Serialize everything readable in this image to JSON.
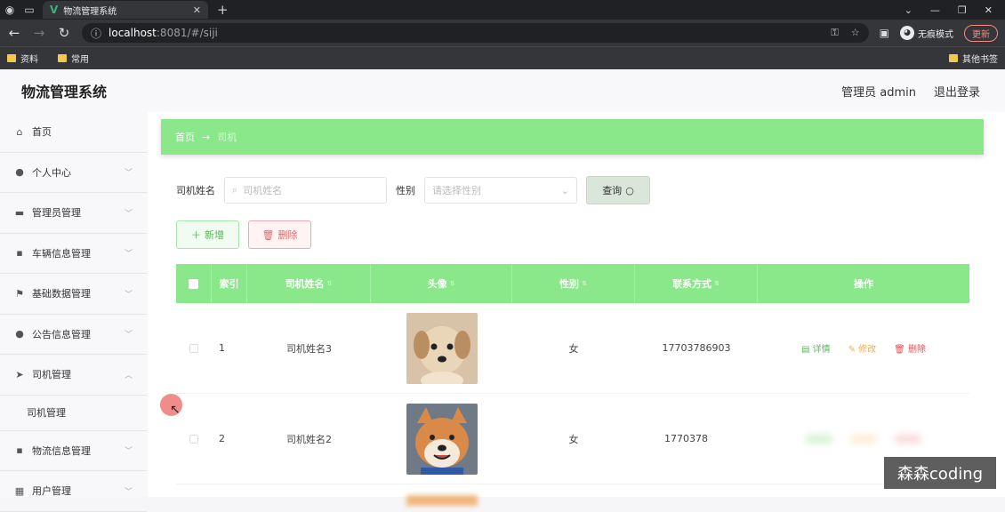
{
  "browser": {
    "tab_title": "物流管理系统",
    "url_host": "localhost",
    "url_path": ":8081/#/siji",
    "incognito_label": "无痕模式",
    "update_label": "更新",
    "bookmarks": [
      "资料",
      "常用"
    ],
    "other_bookmarks": "其他书签"
  },
  "header": {
    "title": "物流管理系统",
    "user": "管理员 admin",
    "logout": "退出登录"
  },
  "sidebar": {
    "items": [
      {
        "label": "首页",
        "icon": "home-icon"
      },
      {
        "label": "个人中心",
        "icon": "user-icon"
      },
      {
        "label": "管理员管理",
        "icon": "briefcase-icon"
      },
      {
        "label": "车辆信息管理",
        "icon": "chat-icon"
      },
      {
        "label": "基础数据管理",
        "icon": "flag-icon"
      },
      {
        "label": "公告信息管理",
        "icon": "bulb-icon"
      },
      {
        "label": "司机管理",
        "icon": "send-icon"
      },
      {
        "label": "物流信息管理",
        "icon": "chat-icon"
      },
      {
        "label": "用户管理",
        "icon": "chart-icon"
      }
    ],
    "submenu": "司机管理"
  },
  "breadcrumb": {
    "home": "首页",
    "arrow": "→",
    "current": "司机"
  },
  "search": {
    "name_label": "司机姓名",
    "name_placeholder": "司机姓名",
    "sex_label": "性别",
    "sex_placeholder": "请选择性别",
    "query_button": "查询"
  },
  "actions": {
    "add": "新增",
    "delete": "删除"
  },
  "table": {
    "headers": [
      "索引",
      "司机姓名",
      "头像",
      "性别",
      "联系方式",
      "操作"
    ],
    "rows": [
      {
        "index": "1",
        "name": "司机姓名3",
        "sex": "女",
        "phone": "17703786903"
      },
      {
        "index": "2",
        "name": "司机姓名2",
        "sex": "女",
        "phone": "1770378"
      }
    ],
    "ops": {
      "detail": "详情",
      "edit": "修改",
      "delete": "删除"
    }
  },
  "watermark": "森森coding"
}
